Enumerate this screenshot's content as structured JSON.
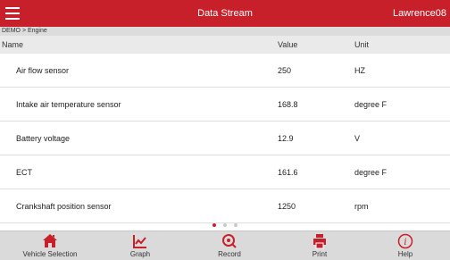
{
  "app": {
    "title": "Data Stream",
    "user": "Lawrence08"
  },
  "breadcrumb": "DEMO > Engine",
  "columns": {
    "name": "Name",
    "value": "Value",
    "unit": "Unit"
  },
  "rows": [
    {
      "name": "Air flow sensor",
      "value": "250",
      "unit": "HZ"
    },
    {
      "name": "Intake air temperature sensor",
      "value": "168.8",
      "unit": "degree F"
    },
    {
      "name": "Battery voltage",
      "value": "12.9",
      "unit": "V"
    },
    {
      "name": "ECT",
      "value": "161.6",
      "unit": "degree F"
    },
    {
      "name": "Crankshaft position sensor",
      "value": "1250",
      "unit": "rpm"
    }
  ],
  "pagination": {
    "pages": 3,
    "active_page": 1
  },
  "bottom_nav": [
    {
      "label": "Vehicle Selection",
      "icon": "home-icon"
    },
    {
      "label": "Graph",
      "icon": "graph-icon"
    },
    {
      "label": "Record",
      "icon": "record-icon"
    },
    {
      "label": "Print",
      "icon": "print-icon"
    },
    {
      "label": "Help",
      "icon": "help-icon"
    }
  ],
  "colors": {
    "brand": "#c8202a",
    "bar": "#dadada"
  }
}
